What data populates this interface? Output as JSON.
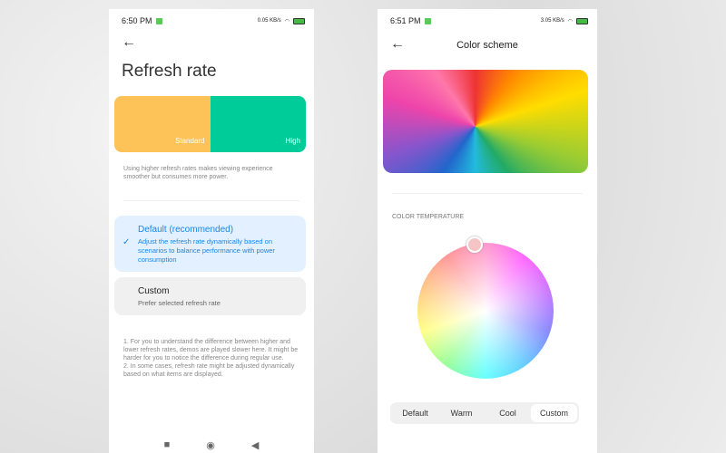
{
  "left": {
    "status": {
      "time": "6:50 PM",
      "speed": "0.05 KB/s"
    },
    "title": "Refresh rate",
    "demo": {
      "standard": "Standard",
      "high": "High",
      "colors": {
        "standard": "#fec358",
        "high": "#00cc99"
      }
    },
    "description": "Using higher refresh rates makes viewing experience smoother but consumes more power.",
    "options": [
      {
        "title": "Default (recommended)",
        "subtitle": "Adjust the refresh rate dynamically based on scenarios to balance performance with power consumption",
        "selected": true
      },
      {
        "title": "Custom",
        "subtitle": "Prefer selected refresh rate",
        "selected": false
      }
    ],
    "notes": "1. For you to understand the difference between higher and lower refresh rates, demos are played slower here. It might be harder for you to notice the difference during regular use.\n2. In some cases, refresh rate might be adjusted dynamically based on what items are displayed."
  },
  "right": {
    "status": {
      "time": "6:51 PM",
      "speed": "3.05 KB/s"
    },
    "title": "Color scheme",
    "section": "COLOR TEMPERATURE",
    "modes": [
      "Default",
      "Warm",
      "Cool",
      "Custom"
    ],
    "selected_mode": "Custom"
  },
  "accent": "#1a86e8"
}
